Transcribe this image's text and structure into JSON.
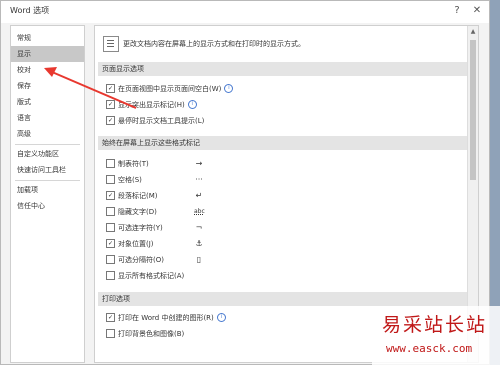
{
  "window": {
    "title": "Word 选项",
    "help_label": "?",
    "close_label": "✕"
  },
  "sidebar": {
    "items": [
      {
        "label": "常规"
      },
      {
        "label": "显示"
      },
      {
        "label": "校对"
      },
      {
        "label": "保存"
      },
      {
        "label": "版式"
      },
      {
        "label": "语言"
      },
      {
        "label": "高级"
      },
      {
        "label": "自定义功能区"
      },
      {
        "label": "快速访问工具栏"
      },
      {
        "label": "加载项"
      },
      {
        "label": "信任中心"
      }
    ],
    "selected": "显示"
  },
  "main": {
    "intro": "更改文档内容在屏幕上的显示方式和在打印时的显示方式。",
    "page_display": {
      "header": "页面显示选项",
      "options": [
        {
          "label": "在页面视图中显示页面间空白(W)",
          "checked": true,
          "info": true
        },
        {
          "label": "显示突出显示标记(H)",
          "checked": true,
          "info": true
        },
        {
          "label": "悬停时显示文档工具提示(L)",
          "checked": true,
          "info": false
        }
      ]
    },
    "formatting_marks": {
      "header": "始终在屏幕上显示这些格式标记",
      "options": [
        {
          "label": "制表符(T)",
          "checked": false,
          "symbol": "→"
        },
        {
          "label": "空格(S)",
          "checked": false,
          "symbol": "···"
        },
        {
          "label": "段落标记(M)",
          "checked": true,
          "symbol": "↵"
        },
        {
          "label": "隐藏文字(D)",
          "checked": false,
          "symbol": "abc"
        },
        {
          "label": "可选连字符(Y)",
          "checked": false,
          "symbol": "¬"
        },
        {
          "label": "对象位置(J)",
          "checked": true,
          "symbol": "⚓"
        },
        {
          "label": "可选分隔符(O)",
          "checked": false,
          "symbol": "▯"
        },
        {
          "label": "显示所有格式标记(A)",
          "checked": false,
          "symbol": ""
        }
      ]
    },
    "print": {
      "header": "打印选项",
      "options": [
        {
          "label": "打印在 Word 中创建的图形(R)",
          "checked": true,
          "info": true
        },
        {
          "label": "打印背景色和图像(B)",
          "checked": false,
          "info": false
        }
      ]
    }
  },
  "check_glyph": "✓",
  "info_glyph": "i",
  "watermark": {
    "text": "易采站长站",
    "url": "www.easck.com"
  },
  "colors": {
    "selected_sidebar": "#c8c8c8",
    "section_header": "#e4e4e4",
    "arrow": "#e8382f",
    "watermark": "#c01818"
  }
}
